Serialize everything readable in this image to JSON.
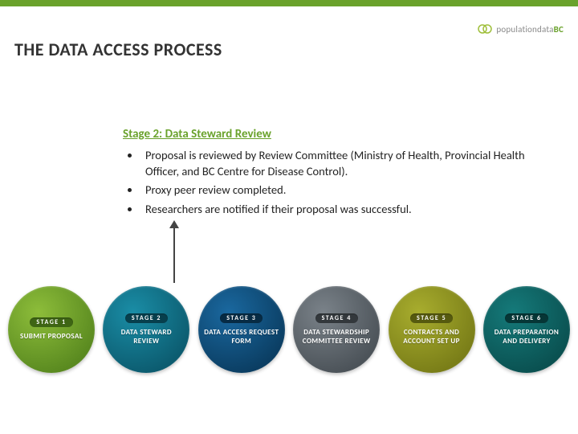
{
  "brand": {
    "name": "populationdata",
    "suffix": "BC"
  },
  "title": "THE DATA ACCESS PROCESS",
  "stage_heading": "Stage 2: Data Steward Review",
  "bullets": [
    "Proposal is reviewed by Review Committee (Ministry of Health, Provincial Health Officer, and BC Centre for Disease Control).",
    "Proxy peer review completed.",
    "Researchers are notified if their proposal was successful."
  ],
  "stages": [
    {
      "tag": "STAGE 1",
      "label": "SUBMIT PROPOSAL"
    },
    {
      "tag": "STAGE 2",
      "label": "DATA STEWARD REVIEW"
    },
    {
      "tag": "STAGE 3",
      "label": "DATA ACCESS REQUEST FORM"
    },
    {
      "tag": "STAGE 4",
      "label": "DATA STEWARDSHIP COMMITTEE REVIEW"
    },
    {
      "tag": "STAGE 5",
      "label": "CONTRACTS AND ACCOUNT SET UP"
    },
    {
      "tag": "STAGE 6",
      "label": "DATA PREPARATION AND DELIVERY"
    }
  ]
}
